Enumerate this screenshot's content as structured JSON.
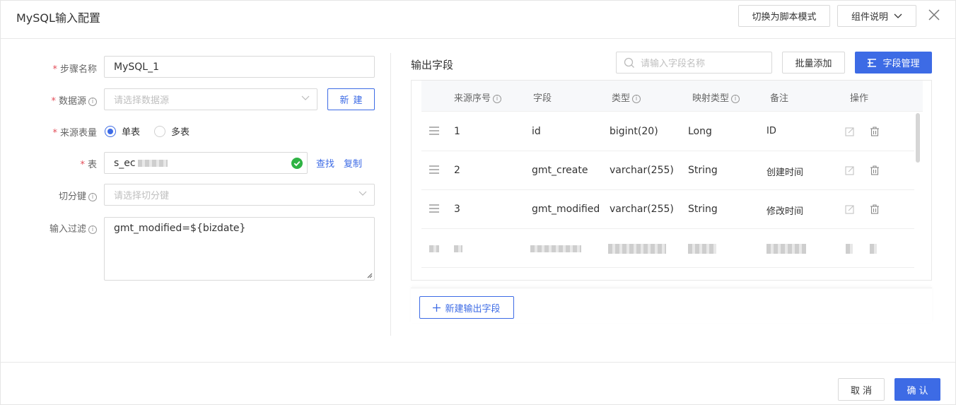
{
  "header": {
    "title": "MySQL输入配置",
    "script_mode_label": "切换为脚本模式",
    "component_doc_label": "组件说明"
  },
  "form": {
    "step_name": {
      "label": "步骤名称",
      "value": "MySQL_1"
    },
    "datasource": {
      "label": "数据源",
      "placeholder": "请选择数据源",
      "new_label": "新建"
    },
    "source_table_count": {
      "label": "来源表量",
      "options": [
        "单表",
        "多表"
      ],
      "selected": "单表"
    },
    "table": {
      "label": "表",
      "value": "s_ec",
      "find_label": "查找",
      "copy_label": "复制"
    },
    "split_key": {
      "label": "切分键",
      "placeholder": "请选择切分键"
    },
    "filter": {
      "label": "输入过滤",
      "value": "gmt_modified=${bizdate}"
    }
  },
  "output": {
    "title": "输出字段",
    "search_placeholder": "请输入字段名称",
    "batch_add_label": "批量添加",
    "field_manage_label": "字段管理",
    "columns": [
      "来源序号",
      "字段",
      "类型",
      "映射类型",
      "备注",
      "操作"
    ],
    "rows": [
      {
        "seq": "1",
        "field": "id",
        "type": "bigint(20)",
        "map_type": "Long",
        "note": "ID"
      },
      {
        "seq": "2",
        "field": "gmt_create",
        "type": "varchar(255)",
        "map_type": "String",
        "note": "创建时间"
      },
      {
        "seq": "3",
        "field": "gmt_modified",
        "type": "varchar(255)",
        "map_type": "String",
        "note": "修改时间"
      }
    ],
    "add_field_label": "新建输出字段"
  },
  "footer": {
    "cancel_label": "取消",
    "confirm_label": "确认"
  },
  "colors": {
    "primary": "#3d6be5",
    "required": "#e34d59",
    "success": "#2fb344"
  }
}
